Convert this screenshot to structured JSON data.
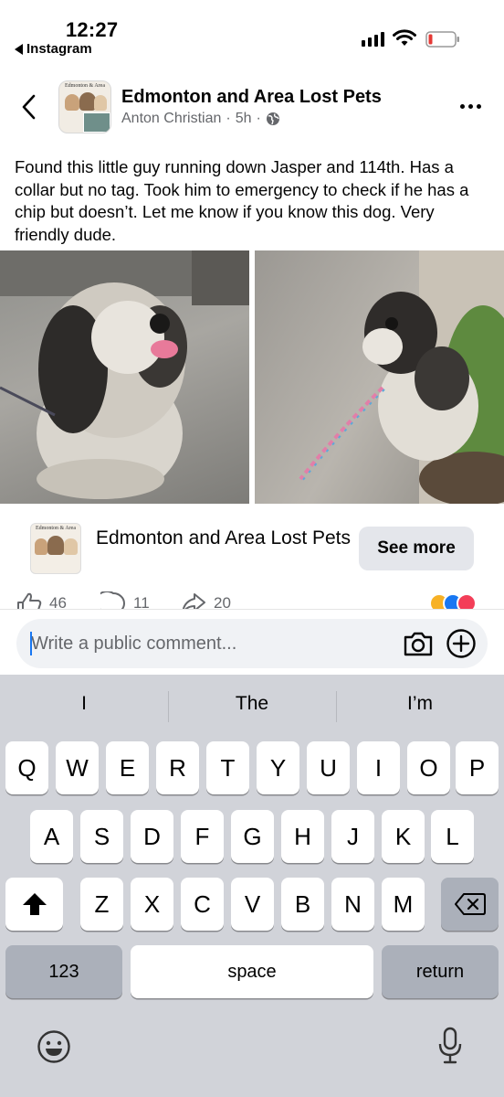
{
  "status_bar": {
    "time": "12:27",
    "back_app": "Instagram"
  },
  "post": {
    "group_name": "Edmonton and Area Lost Pets",
    "author": "Anton Christian",
    "age": "5h",
    "separator": "·",
    "text": "Found this little guy running down Jasper and 114th. Has a collar but no tag. Took him to emergency to check if he has a chip but doesn’t. Let me know if you know this dog. Very friendly dude.",
    "avatar_title": "Edmonton & Area"
  },
  "group_card": {
    "name": "Edmonton and Area Lost Pets",
    "see_more_label": "See more",
    "avatar_title": "Edmonton & Area"
  },
  "reactions": {
    "likes": "46",
    "comments": "11",
    "shares": "20",
    "colors": {
      "care": "#f7b125",
      "like": "#1877f2",
      "love": "#f33e58"
    }
  },
  "comment": {
    "placeholder": "Write a public comment..."
  },
  "keyboard": {
    "suggestions": [
      "I",
      "The",
      "I’m"
    ],
    "row1": [
      "Q",
      "W",
      "E",
      "R",
      "T",
      "Y",
      "U",
      "I",
      "O",
      "P"
    ],
    "row2": [
      "A",
      "S",
      "D",
      "F",
      "G",
      "H",
      "J",
      "K",
      "L"
    ],
    "row3": [
      "Z",
      "X",
      "C",
      "V",
      "B",
      "N",
      "M"
    ],
    "numbers_label": "123",
    "space_label": "space",
    "return_label": "return"
  },
  "icons": {
    "back": "chevron-left-icon",
    "more": "more-dots-icon",
    "globe": "globe-icon",
    "like": "thumbs-up-icon",
    "comment": "comment-bubble-icon",
    "share": "share-arrow-icon",
    "camera": "camera-icon",
    "plus": "plus-circle-icon",
    "shift": "shift-icon",
    "delete": "backspace-icon",
    "emoji": "emoji-icon",
    "mic": "microphone-icon"
  }
}
